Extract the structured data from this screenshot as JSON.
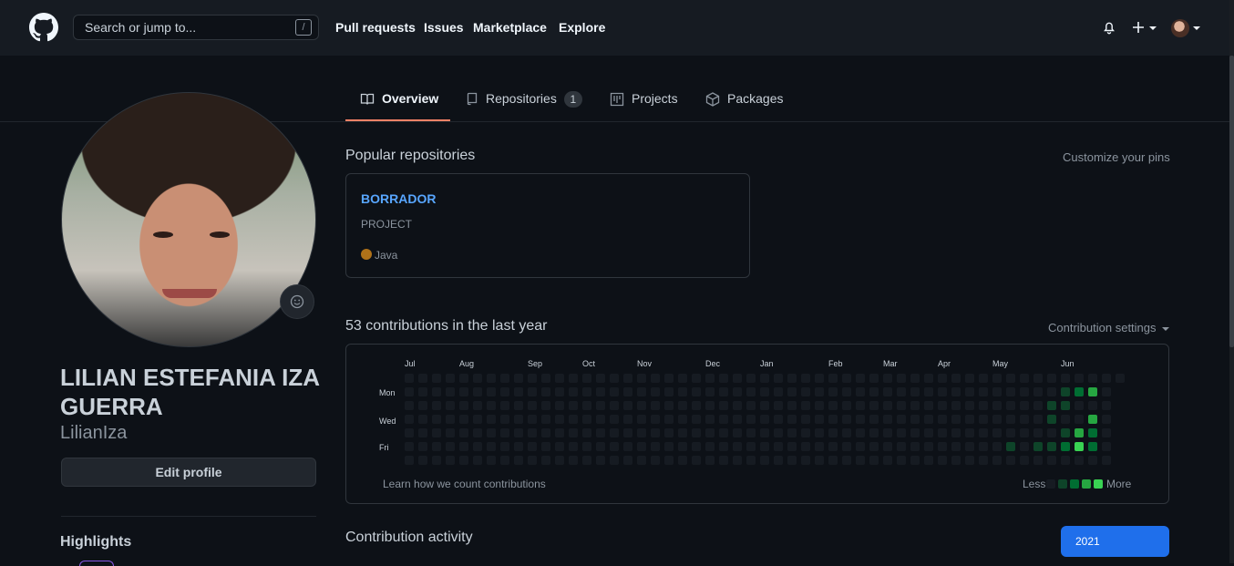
{
  "header": {
    "search_placeholder": "Search or jump to...",
    "search_shortcut": "/",
    "nav": [
      "Pull requests",
      "Issues",
      "Marketplace",
      "Explore"
    ]
  },
  "tabs": [
    {
      "label": "Overview",
      "icon": "book-icon",
      "active": true
    },
    {
      "label": "Repositories",
      "icon": "repo-icon",
      "count": "1"
    },
    {
      "label": "Projects",
      "icon": "project-icon"
    },
    {
      "label": "Packages",
      "icon": "package-icon"
    }
  ],
  "profile": {
    "full_name": "LILIAN ESTEFANIA IZA GUERRA",
    "username": "LilianIza",
    "edit_button": "Edit profile",
    "highlights_title": "Highlights"
  },
  "popular": {
    "title": "Popular repositories",
    "customize_link": "Customize your pins",
    "repos": [
      {
        "name": "BORRADOR",
        "description": "PROJECT",
        "language": "Java",
        "language_color": "#b07219"
      }
    ]
  },
  "contributions": {
    "title": "53 contributions in the last year",
    "settings_link": "Contribution settings",
    "months": [
      "Jul",
      "Aug",
      "Sep",
      "Oct",
      "Nov",
      "Dec",
      "Jan",
      "Feb",
      "Mar",
      "Apr",
      "May",
      "Jun"
    ],
    "days": [
      "Mon",
      "Wed",
      "Fri"
    ],
    "learn_link": "Learn how we count contributions",
    "legend_less": "Less",
    "legend_more": "More",
    "colors": [
      "#161b22",
      "#0e4429",
      "#006d32",
      "#26a641",
      "#39d353"
    ]
  },
  "activity": {
    "title": "Contribution activity",
    "year": "2021"
  }
}
